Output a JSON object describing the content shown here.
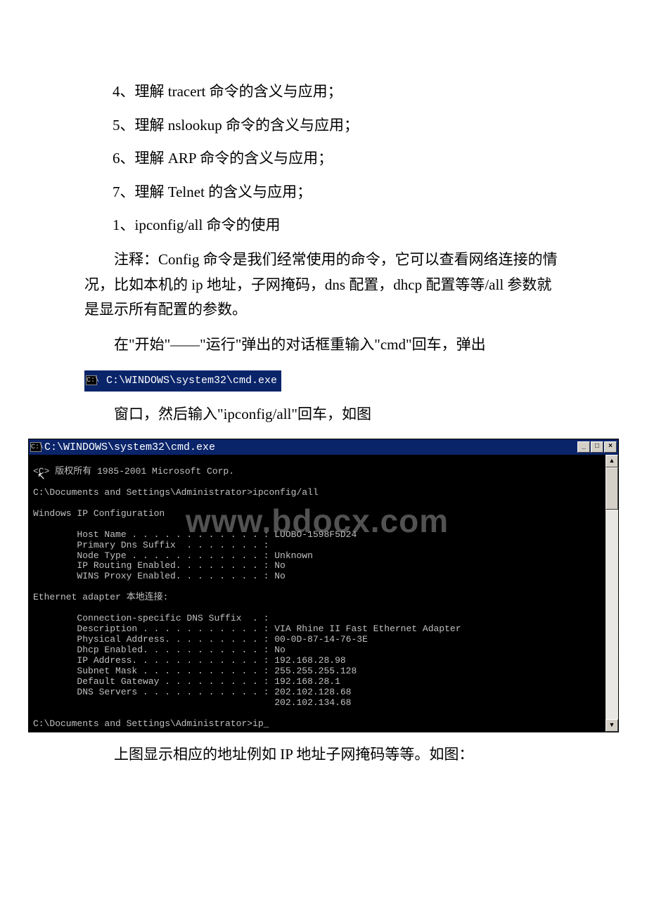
{
  "items": {
    "i4": "4、理解 tracert 命令的含义与应用；",
    "i5": "5、理解 nslookup 命令的含义与应用；",
    "i6": "6、理解 ARP 命令的含义与应用；",
    "i7": "7、理解 Telnet 的含义与应用；",
    "i1": "1、ipconfig/all 命令的使用"
  },
  "paras": {
    "p1": "注释：Config 命令是我们经常使用的命令，它可以查看网络连接的情况，比如本机的 ip 地址，子网掩码，dns 配置，dhcp 配置等等/all 参数就是显示所有配置的参数。",
    "p2a": "在\"开始\"——\"运行\"弹出的对话框重输入\"cmd\"回车，弹出",
    "p3": "窗口，然后输入\"ipconfig/all\"回车，如图",
    "p4": "上图显示相应的地址例如 IP 地址子网掩码等等。如图："
  },
  "small_title": {
    "icon": "C:\\",
    "text": " C:\\WINDOWS\\system32\\cmd.exe"
  },
  "cmd_window": {
    "icon": "C:\\",
    "title": " C:\\WINDOWS\\system32\\cmd.exe",
    "btn_min": "_",
    "btn_max": "□",
    "btn_close": "×",
    "scroll_up": "▲",
    "scroll_down": "▼",
    "watermark": "www.bdocx.com",
    "lines": {
      "l0": "<C> 版权所有 1985-2001 Microsoft Corp.",
      "l1": "",
      "l2": "C:\\Documents and Settings\\Administrator>ipconfig/all",
      "l3": "",
      "l4": "Windows IP Configuration",
      "l5": "",
      "l6": "        Host Name . . . . . . . . . . . . : LUOBO-1598F5D24",
      "l7": "        Primary Dns Suffix  . . . . . . . :",
      "l8": "        Node Type . . . . . . . . . . . . : Unknown",
      "l9": "        IP Routing Enabled. . . . . . . . : No",
      "l10": "        WINS Proxy Enabled. . . . . . . . : No",
      "l11": "",
      "l12": "Ethernet adapter 本地连接:",
      "l13": "",
      "l14": "        Connection-specific DNS Suffix  . :",
      "l15": "        Description . . . . . . . . . . . : VIA Rhine II Fast Ethernet Adapter",
      "l16": "        Physical Address. . . . . . . . . : 00-0D-87-14-76-3E",
      "l17": "        Dhcp Enabled. . . . . . . . . . . : No",
      "l18": "        IP Address. . . . . . . . . . . . : 192.168.28.98",
      "l19": "        Subnet Mask . . . . . . . . . . . : 255.255.255.128",
      "l20": "        Default Gateway . . . . . . . . . : 192.168.28.1",
      "l21": "        DNS Servers . . . . . . . . . . . : 202.102.128.68",
      "l22": "                                            202.102.134.68",
      "l23": "",
      "l24": "C:\\Documents and Settings\\Administrator>ip_"
    }
  }
}
